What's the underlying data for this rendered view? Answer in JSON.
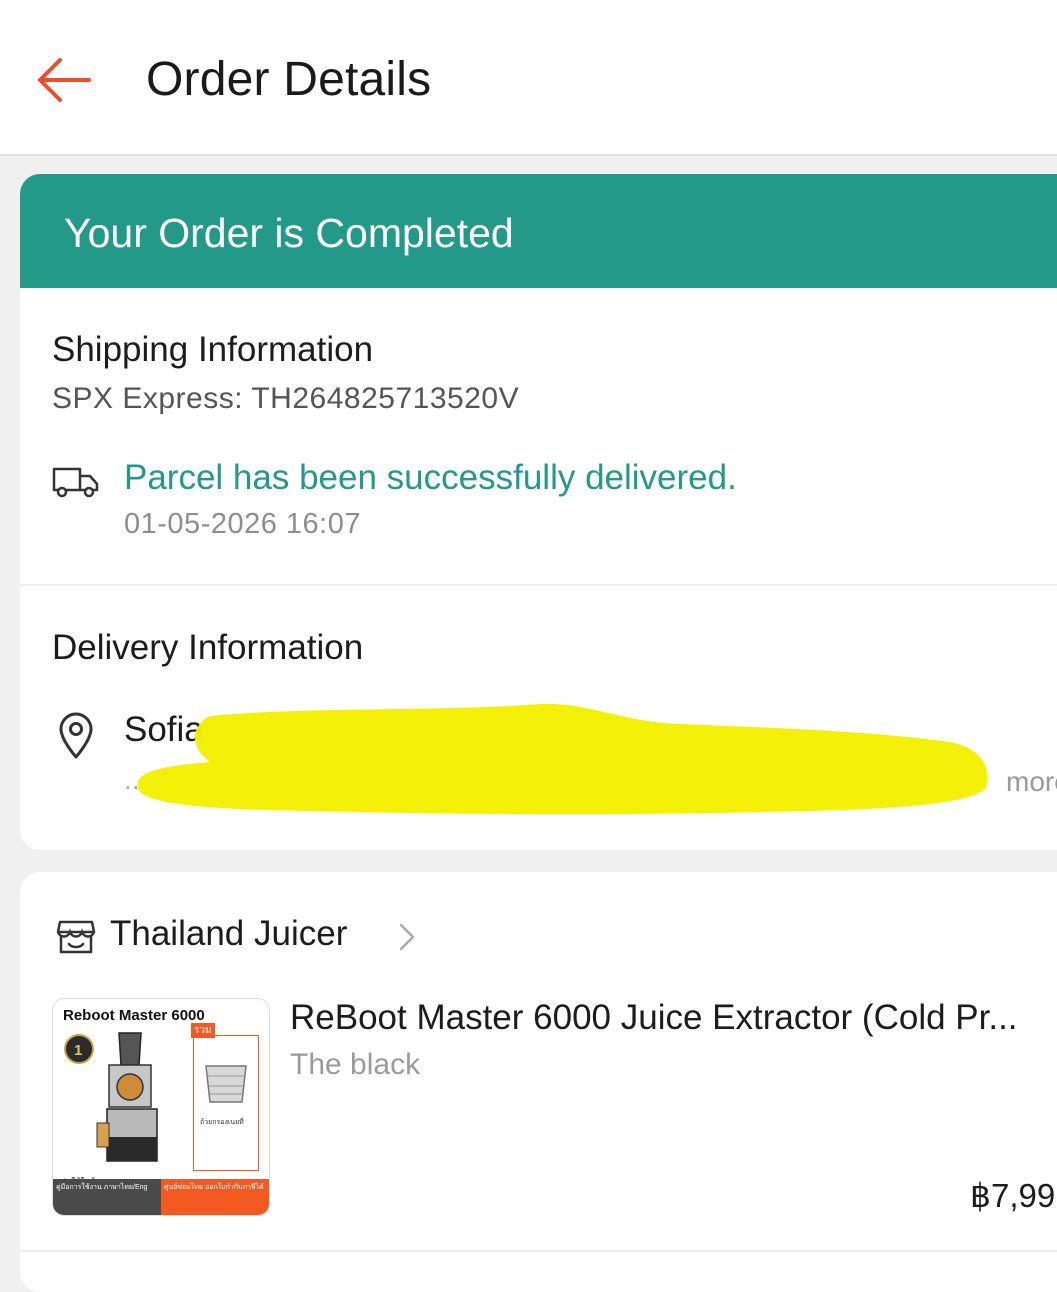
{
  "header": {
    "title": "Order Details",
    "back_icon": "arrow-left-icon",
    "accent_color": "#ee4d2d"
  },
  "status": {
    "text": "Your Order is Completed",
    "color": "#23998a"
  },
  "shipping": {
    "title": "Shipping Information",
    "carrier": "SPX Express: TH264825713520V",
    "status_text": "Parcel has been successfully delivered.",
    "timestamp": "01-05-2026 16:07",
    "icon": "truck-icon"
  },
  "delivery": {
    "title": "Delivery Information",
    "recipient": "Sofia",
    "address": "...",
    "more_label": "more",
    "icon": "location-pin-icon"
  },
  "shop": {
    "name": "Thailand Juicer",
    "icon": "shop-icon"
  },
  "product": {
    "name": "ReBoot Master 6000 Juice Extractor (Cold Pr...",
    "variant": "The black",
    "price": "฿7,99",
    "thumbnail": {
      "brand": "Reboot Master 6000",
      "tag": "รวม",
      "caption": "ถ้วยกรองเนยที่",
      "sub": "-รุ่นใช้ในบ้าน",
      "bottom_left": "คู่มือการใช้งาน ภาษาไทย/Eng",
      "bottom_right": "ศูนย์ซ่อมไทย ออกใบกำกับภาษีได้"
    }
  }
}
